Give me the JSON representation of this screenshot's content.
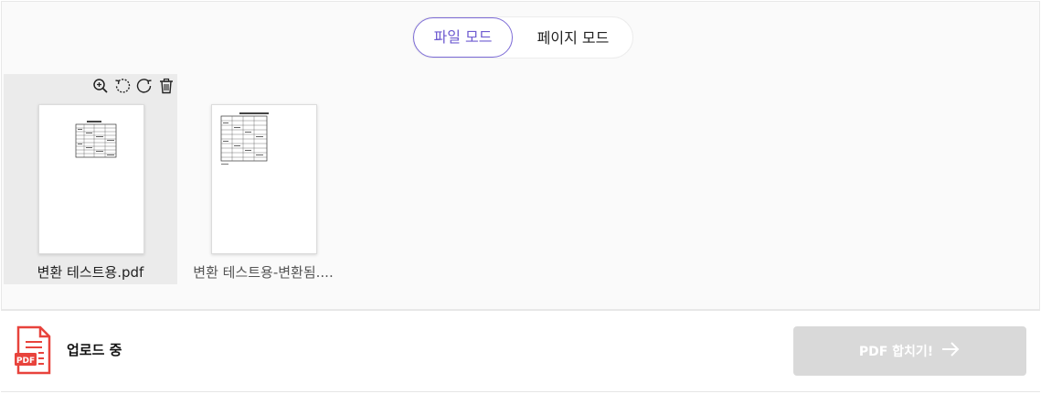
{
  "mode_toggle": {
    "file_mode_label": "파일 모드",
    "page_mode_label": "페이지 모드",
    "active": "file"
  },
  "files": [
    {
      "name": "변환 테스트용.pdf",
      "selected": true
    },
    {
      "name": "변환 테스트용-변환됨....",
      "selected": false
    }
  ],
  "card_tools": [
    "zoom-in-icon",
    "rotate-left-icon",
    "rotate-right-icon",
    "trash-icon"
  ],
  "footer": {
    "status_text": "업로드 중",
    "merge_button_label": "PDF 합치기!",
    "icon_label": "PDF"
  },
  "colors": {
    "accent": "#6e5bd0",
    "pdf_red": "#e8433c",
    "disabled_button": "#d9d9d9"
  }
}
